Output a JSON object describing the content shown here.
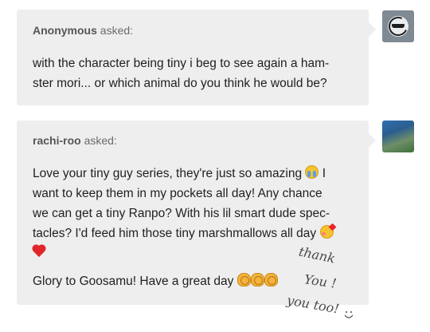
{
  "asks": [
    {
      "asker_name": "Anonymous",
      "asked_label": "asked:",
      "avatar_icon": "anonymous-sunglasses-avatar",
      "lines": [
        "with the character being tiny i beg to see again a ham-",
        "ster mori... or which animal do you think he would be?"
      ]
    },
    {
      "asker_name": "rachi-roo",
      "asked_label": "asked:",
      "avatar_icon": "user-avatar",
      "lines": [
        "Love your tiny guy series, they're just so amazing",
        "I",
        "want to keep them in my pockets all day! Any chance",
        "we can get a tiny Ranpo? With his lil smart dude spec-",
        "tacles? I'd feed him those tiny marshmallows all day"
      ],
      "closing": "Glory to Goosamu! Have a great day",
      "emojis": [
        "loudly-crying-face",
        "smiling-face-with-hearts",
        "red-heart",
        "clapping-hands",
        "clapping-hands",
        "clapping-hands"
      ]
    }
  ],
  "handwriting": {
    "line1": "thank",
    "line2": "You !",
    "line3": "you too!"
  },
  "colors": {
    "bubble": "#eeeeee",
    "text": "#1f1f1f",
    "asker": "#555555"
  }
}
